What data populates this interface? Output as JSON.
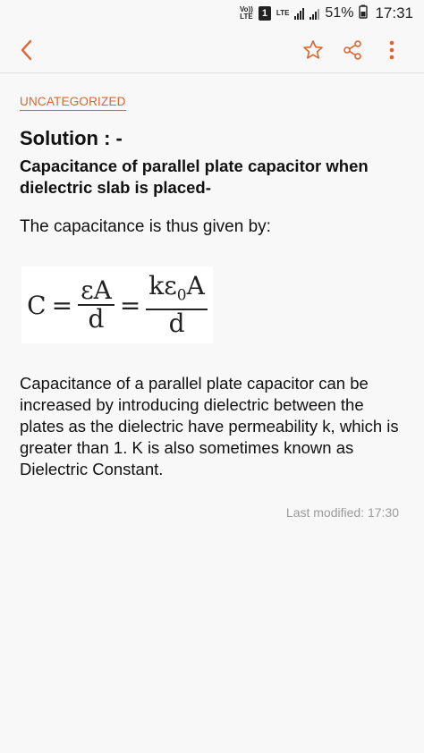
{
  "status_bar": {
    "volte_top": "Vo))",
    "volte_bottom": "LTE",
    "sim": "1",
    "lte": "LTE",
    "battery": "51%",
    "time": "17:31"
  },
  "note": {
    "category": "UNCATEGORIZED",
    "title": "Solution : -",
    "subtitle": "Capacitance of parallel plate capacitor when dielectric slab is placed-",
    "intro": "The capacitance is thus given by:",
    "formula": {
      "lhs": "C",
      "eq": "=",
      "frac1_num": "εA",
      "frac1_den": "d",
      "frac2_num_k": "kε",
      "frac2_sub": "0",
      "frac2_num_a": "A",
      "frac2_den": "d"
    },
    "body": "Capacitance of a parallel plate capacitor can be increased by introducing dielectric between the plates as the dielectric have permeability k, which is greater than 1. K is also sometimes known as Dielectric Constant.",
    "last_modified": "Last modified: 17:30"
  },
  "colors": {
    "accent": "#e2622d",
    "muted": "#9a9a9a",
    "background": "#f8f8f8"
  },
  "icons": [
    "back-arrow-icon",
    "star-icon",
    "share-icon",
    "more-vertical-icon"
  ]
}
